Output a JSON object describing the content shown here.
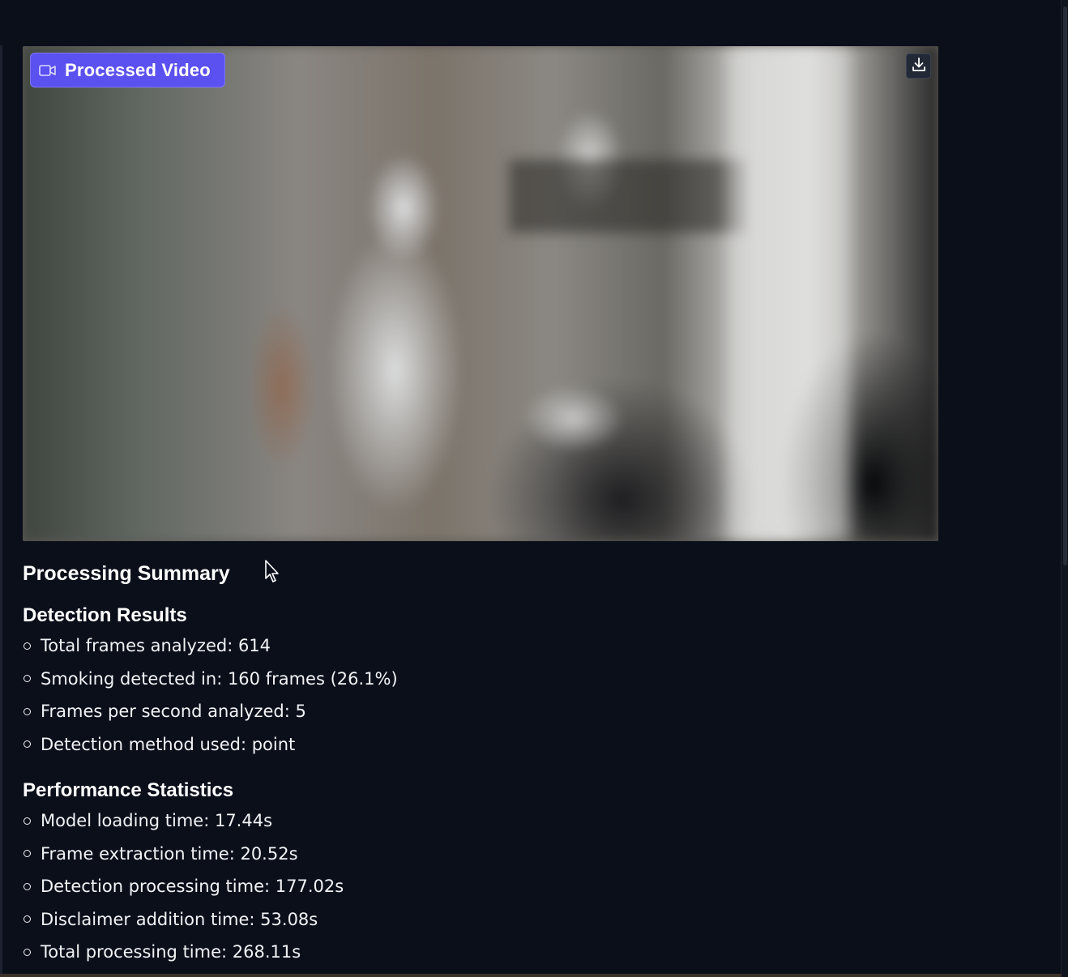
{
  "video": {
    "badge_label": "Processed Video",
    "badge_color": "#5b50f0",
    "badge_icon": "video-camera-icon",
    "download_icon": "download-icon"
  },
  "summary": {
    "title": "Processing Summary",
    "detection": {
      "heading": "Detection Results",
      "items": [
        "Total frames analyzed: 614",
        "Smoking detected in: 160 frames (26.1%)",
        "Frames per second analyzed: 5",
        "Detection method used: point"
      ]
    },
    "performance": {
      "heading": "Performance Statistics",
      "items": [
        "Model loading time: 17.44s",
        "Frame extraction time: 20.52s",
        "Detection processing time: 177.02s",
        "Disclaimer addition time: 53.08s",
        "Total processing time: 268.11s"
      ]
    }
  },
  "colors": {
    "background": "#0b0f1a",
    "text": "#ffffff",
    "accent": "#5b50f0"
  }
}
